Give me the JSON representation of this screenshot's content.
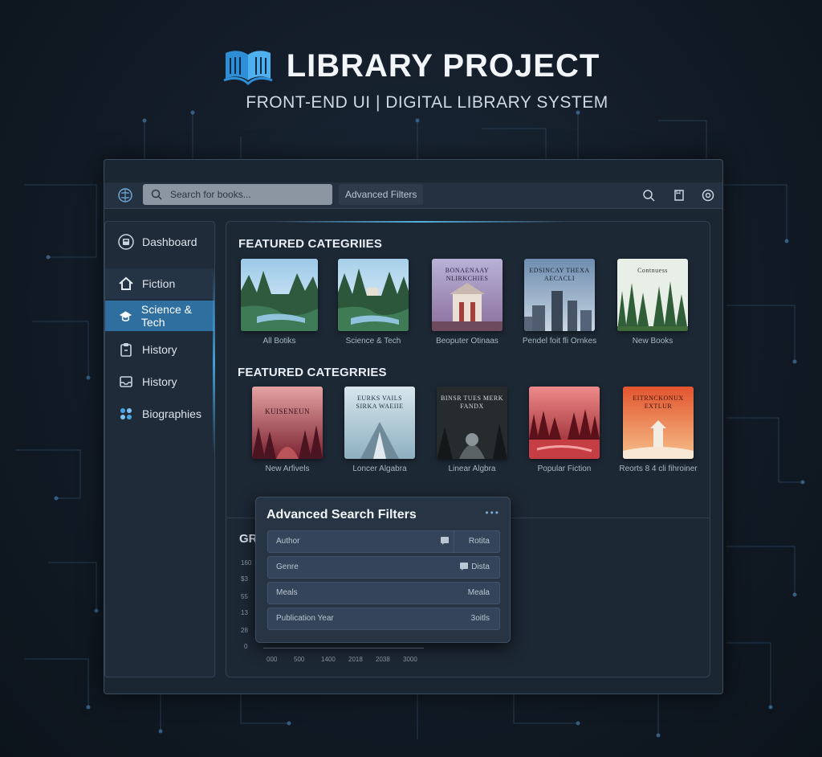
{
  "header": {
    "title": "LIBRARY PROJECT",
    "subtitle": "FRONT-END UI | DIGITAL LIBRARY SYSTEM"
  },
  "topbar": {
    "search_placeholder": "Search for books...",
    "advanced_filters_label": "Advanced Filters",
    "icons": [
      "search-icon",
      "bookmark-icon",
      "settings-icon"
    ]
  },
  "sidebar": {
    "items": [
      {
        "label": "Dashboard",
        "icon": "dashboard-icon"
      },
      {
        "label": "Fiction",
        "icon": "home-icon"
      },
      {
        "label": "Science & Tech",
        "icon": "flask-icon",
        "active": true
      },
      {
        "label": "History",
        "icon": "clipboard-icon"
      },
      {
        "label": "History",
        "icon": "inbox-icon"
      },
      {
        "label": "Biographies",
        "icon": "grid-icon"
      }
    ]
  },
  "main": {
    "section1_title": "FEATURED CATEGRIIES",
    "section1_cards": [
      {
        "label": "All Botiks",
        "cover_text": ""
      },
      {
        "label": "Science & Tech",
        "cover_text": ""
      },
      {
        "label": "Beoputer Otinaas",
        "cover_text": "BONAENAAY NLIRKCHIES"
      },
      {
        "label": "Pendel foit fli Ornkes",
        "cover_text": "EDSINCAY THEXA AECACLI"
      },
      {
        "label": "New Books",
        "cover_text": "Contnuess"
      }
    ],
    "section2_title": "FEATURED CATEGRRIES",
    "section2_cards": [
      {
        "label": "New Arfivels",
        "cover_text": "KUISENEUN"
      },
      {
        "label": "Loncer Algabra",
        "cover_text": "EURKS VAILS SIRKA WAEIIE"
      },
      {
        "label": "Linear Algbra",
        "cover_text": "BINSR TUES MERK FANDX"
      },
      {
        "label": "Popular Fiction",
        "cover_text": ""
      },
      {
        "label": "Reorts 8 4 cli fihroiner",
        "cover_text": "EITRNCKONUX EXTLUR"
      }
    ],
    "chart_fragment": {
      "label": "GR",
      "y_ticks": [
        "160",
        "$3",
        "55",
        "13",
        "28",
        "0"
      ],
      "x_ticks": [
        "000",
        "500",
        "1400",
        "2018",
        "2038",
        "3000"
      ]
    }
  },
  "filters": {
    "title": "Advanced Search Filters",
    "dots": "•••",
    "rows": [
      {
        "label": "Author",
        "value": "Rotita",
        "icon": "comment-icon"
      },
      {
        "label": "Genre",
        "value": "Dista",
        "icon": "comment-icon"
      },
      {
        "label": "Meals",
        "value": "Meala",
        "icon": ""
      },
      {
        "label": "Publication Year",
        "value": "3oitls",
        "icon": ""
      }
    ]
  },
  "colors": {
    "background": "#121b26",
    "accent": "#2f6f9f",
    "glow": "#46aae6",
    "panel": "#1d2835"
  }
}
